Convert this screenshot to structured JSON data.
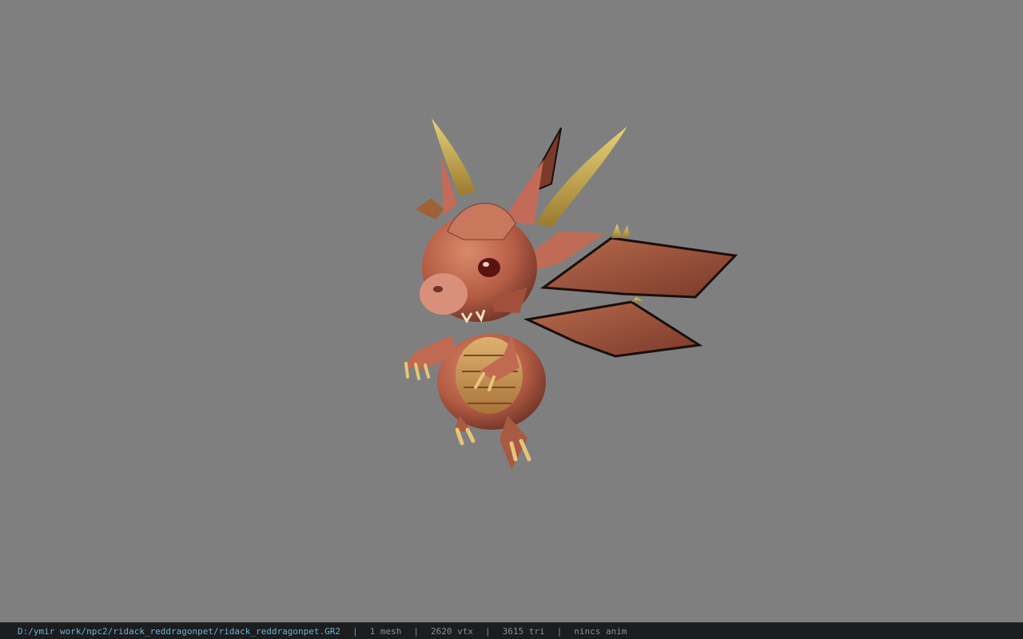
{
  "viewport": {
    "background": "#7f7f7f",
    "model_name": "ridack_reddragonpet"
  },
  "status_bar": {
    "file_path": "D:/ymir work/npc2/ridack_reddragonpet/ridack_reddragonpet.GR2",
    "separator": "|",
    "mesh_count": "1 mesh",
    "vertex_count": "2620 vtx",
    "triangle_count": "3615 tri",
    "anim_status": "nincs anim"
  },
  "colors": {
    "status_bg": "#1b1d1e",
    "path_text": "#6fb3d6",
    "stat_text": "#8a8f94"
  }
}
